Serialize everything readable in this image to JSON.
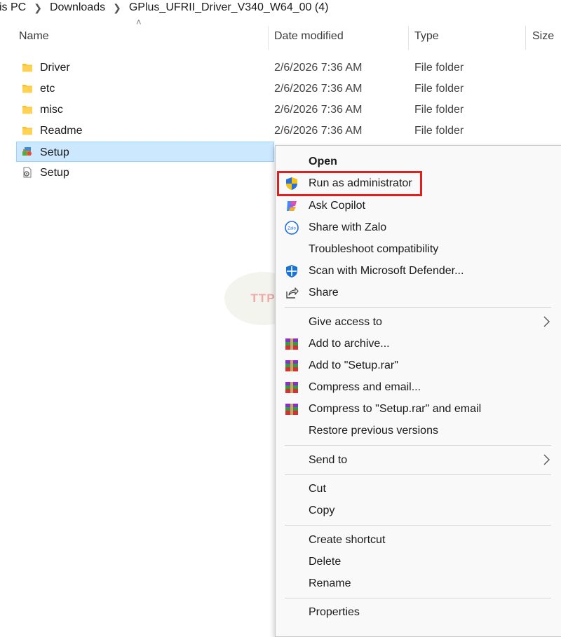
{
  "breadcrumb": [
    "is PC",
    "Downloads",
    "GPlus_UFRII_Driver_V340_W64_00 (4)"
  ],
  "columns": {
    "name": "Name",
    "date": "Date modified",
    "type": "Type",
    "size": "Size"
  },
  "files": [
    {
      "name": "Driver",
      "date": "2/6/2026 7:36 AM",
      "type": "File folder",
      "icon": "folder-icon"
    },
    {
      "name": "etc",
      "date": "2/6/2026 7:36 AM",
      "type": "File folder",
      "icon": "folder-icon"
    },
    {
      "name": "misc",
      "date": "2/6/2026 7:36 AM",
      "type": "File folder",
      "icon": "folder-icon"
    },
    {
      "name": "Readme",
      "date": "2/6/2026 7:36 AM",
      "type": "File folder",
      "icon": "folder-icon"
    },
    {
      "name": "Setup",
      "selected": true,
      "icon": "setup-installer-icon"
    },
    {
      "name": "Setup",
      "icon": "config-file-icon"
    }
  ],
  "context_menu": {
    "items": [
      {
        "label": "Open",
        "bold": true
      },
      {
        "label": "Run as administrator",
        "icon": "uac-shield-icon",
        "highlighted": true
      },
      {
        "label": "Ask Copilot",
        "icon": "copilot-icon"
      },
      {
        "label": "Share with Zalo",
        "icon": "zalo-icon",
        "icon_text": "Zalo"
      },
      {
        "label": "Troubleshoot compatibility"
      },
      {
        "label": "Scan with Microsoft Defender...",
        "icon": "defender-icon"
      },
      {
        "label": "Share",
        "icon": "share-icon"
      },
      {
        "label": "Give access to",
        "submenu": true
      },
      {
        "label": "Add to archive...",
        "icon": "winrar-icon"
      },
      {
        "label": "Add to \"Setup.rar\"",
        "icon": "winrar-icon"
      },
      {
        "label": "Compress and email...",
        "icon": "winrar-icon"
      },
      {
        "label": "Compress to \"Setup.rar\" and email",
        "icon": "winrar-icon"
      },
      {
        "label": "Restore previous versions"
      },
      {
        "label": "Send to",
        "submenu": true
      },
      {
        "label": "Cut"
      },
      {
        "label": "Copy"
      },
      {
        "label": "Create shortcut"
      },
      {
        "label": "Delete"
      },
      {
        "label": "Rename"
      },
      {
        "label": "Properties"
      }
    ]
  },
  "watermark": {
    "text": "TTP"
  },
  "colors": {
    "selection": "#cce8ff",
    "highlight_border": "#e0201f",
    "folder": "#f8c12c"
  }
}
